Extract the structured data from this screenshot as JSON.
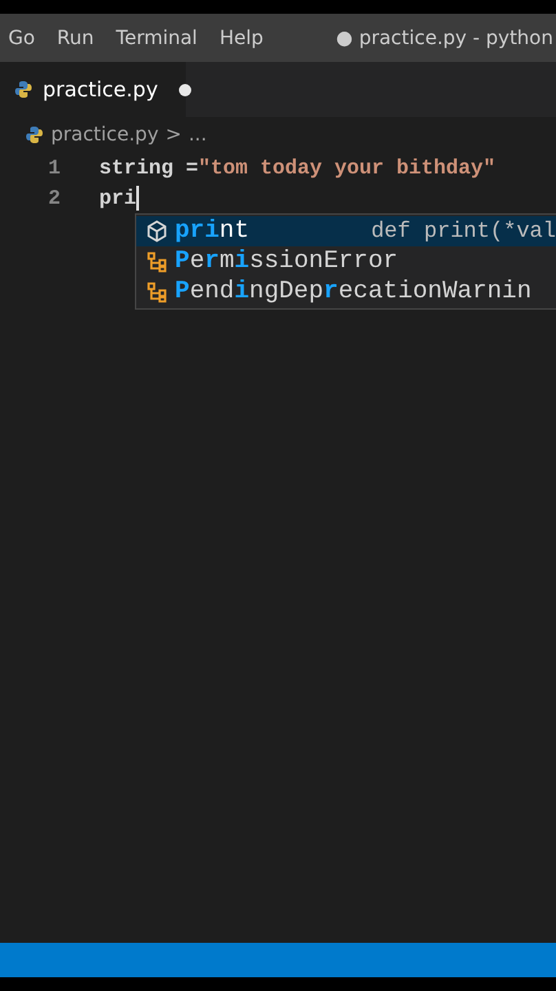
{
  "menu": [
    "Go",
    "Run",
    "Terminal",
    "Help"
  ],
  "window": {
    "title": "● practice.py - python"
  },
  "tabs": [
    {
      "label": "practice.py",
      "selected": true,
      "modified": true
    }
  ],
  "breadcrumb": {
    "file": "practice.py",
    "separator": ">",
    "rest": "..."
  },
  "lines": [
    {
      "number": "1",
      "tokens": [
        {
          "kind": "plain",
          "text": "string ="
        },
        {
          "kind": "string",
          "text": "\"tom today your bithday\""
        }
      ]
    },
    {
      "number": "2",
      "tokens": [
        {
          "kind": "plain",
          "text": "pri"
        }
      ],
      "cursor": true
    }
  ],
  "suggestions": [
    {
      "kind": "method",
      "label": "**pri**nt",
      "detail": "def print(*val",
      "selected": true
    },
    {
      "kind": "class",
      "label": "**P**e**r**m**i**ssionError",
      "selected": false
    },
    {
      "kind": "class",
      "label": "**P**end**i**ngDep**r**ecationWarnin",
      "selected": false
    }
  ]
}
